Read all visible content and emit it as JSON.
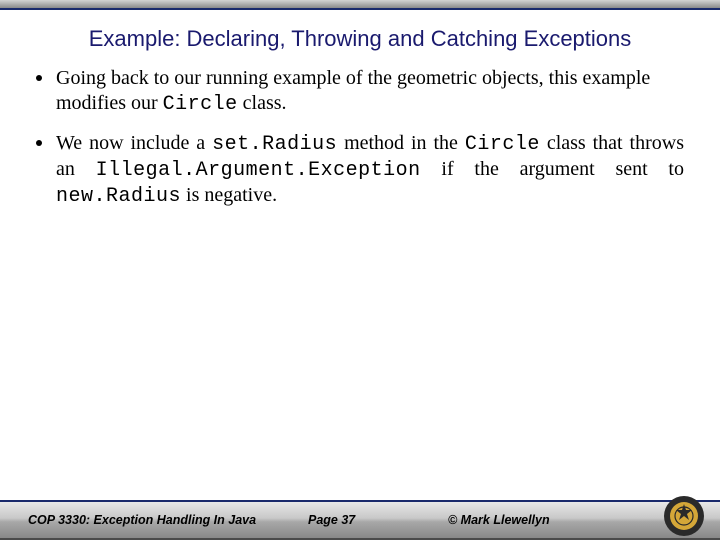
{
  "title": "Example: Declaring, Throwing and Catching Exceptions",
  "bullets": {
    "b1_pre": "Going back to our running example of the geometric objects, this example modifies our ",
    "b1_code": "Circle",
    "b1_post": " class.",
    "b2_a": "We now include a ",
    "b2_code1": "set.Radius",
    "b2_b": " method in the ",
    "b2_code2": "Circle",
    "b2_c": " class that throws an ",
    "b2_code3": "Illegal.Argument.Exception",
    "b2_d": " if the argument sent to ",
    "b2_code4": "new.Radius",
    "b2_e": " is negative."
  },
  "footer": {
    "left": "COP 3330: Exception Handling In Java",
    "center": "Page 37",
    "right": "© Mark Llewellyn"
  }
}
